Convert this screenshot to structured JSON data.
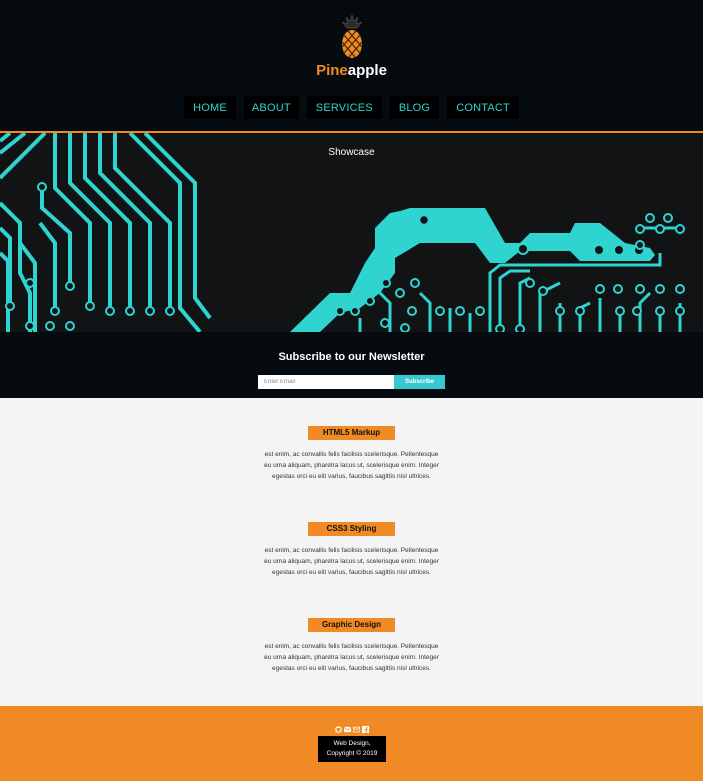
{
  "brand": {
    "part1": "Pine",
    "part2": "apple"
  },
  "nav": [
    {
      "label": "HOME"
    },
    {
      "label": "ABOUT"
    },
    {
      "label": "SERVICES"
    },
    {
      "label": "BLOG"
    },
    {
      "label": "CONTACT"
    }
  ],
  "showcase": {
    "title": "Showcase"
  },
  "newsletter": {
    "title": "Subscribe to our Newsletter",
    "email_placeholder": "Enter Email",
    "button_label": "Subscribe"
  },
  "features": [
    {
      "title": "HTML5 Markup",
      "text": "est enim, ac convallis felis facilisis scelerisque. Pellentesque eu urna aliquam, pharetra lacus ut, scelerisque enim. Integer egestas orci eu elit varius, faucibus sagittis nisl ultrices."
    },
    {
      "title": "CSS3 Styling",
      "text": "est enim, ac convallis felis facilisis scelerisque. Pellentesque eu urna aliquam, pharetra lacus ut, scelerisque enim. Integer egestas orci eu elit varius, faucibus sagittis nisl ultrices."
    },
    {
      "title": "Graphic Design",
      "text": "est enim, ac convallis felis facilisis scelerisque. Pellentesque eu urna aliquam, pharetra lacus ut, scelerisque enim. Integer egestas orci eu elit varius, faucibus sagittis nisl ultrices."
    }
  ],
  "footer": {
    "line1": "Web Design,",
    "line2": "Copyright © 2019",
    "social_icons": [
      "github-icon",
      "email-icon",
      "envelope-icon",
      "facebook-icon"
    ]
  },
  "colors": {
    "accent": "#f08a24",
    "teal": "#2fd3d0",
    "dark": "#050b0e"
  }
}
